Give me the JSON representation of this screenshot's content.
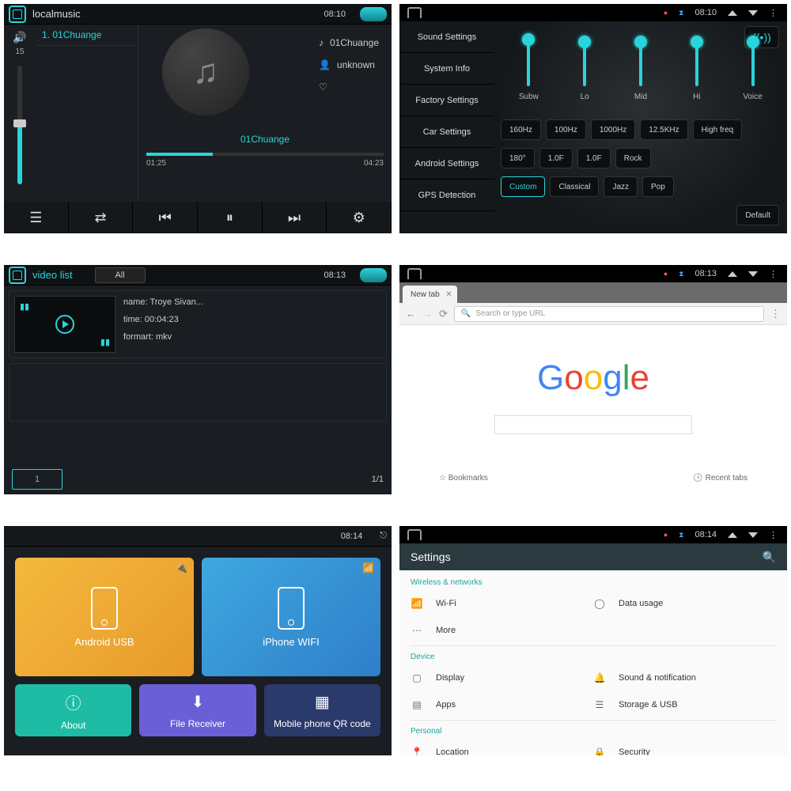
{
  "p1": {
    "title": "localmusic",
    "clock": "08:10",
    "volume_label": "15",
    "track": "1. 01Chuange",
    "song": "01Chuange",
    "artist": "unknown",
    "now_label": "01Chuange",
    "elapsed": "01:25",
    "total": "04:23"
  },
  "p2": {
    "clock": "08:10",
    "menu": [
      "Sound Settings",
      "System Info",
      "Factory Settings",
      "Car Settings",
      "Android Settings",
      "GPS Detection"
    ],
    "sliders": [
      "Subw",
      "Lo",
      "Mid",
      "Hi",
      "Voice"
    ],
    "freq": [
      "160Hz",
      "100Hz",
      "1000Hz",
      "12.5KHz",
      "High freq"
    ],
    "row2": [
      "180°",
      "1.0F",
      "1.0F",
      "Rock"
    ],
    "presets": [
      "Custom",
      "Classical",
      "Jazz",
      "Pop"
    ],
    "default": "Default"
  },
  "p3": {
    "title": "video list",
    "all": "All",
    "clock": "08:13",
    "name_lbl": "name:",
    "name_val": "Troye Sivan...",
    "time_lbl": "time:",
    "time_val": "00:04:23",
    "fmt_lbl": "formart:",
    "fmt_val": "mkv",
    "page_btn": "1",
    "page_of": "1/1"
  },
  "p4": {
    "clock": "08:13",
    "tab": "New tab",
    "placeholder": "Search or type URL",
    "bookmarks": "Bookmarks",
    "recent": "Recent tabs"
  },
  "p5": {
    "clock": "08:14",
    "android": "Android USB",
    "iphone": "iPhone WIFI",
    "about": "About",
    "file": "File Receiver",
    "qr": "Mobile phone QR code"
  },
  "p6": {
    "clock": "08:14",
    "title": "Settings",
    "s1": "Wireless & networks",
    "wifi": "Wi-Fi",
    "data": "Data usage",
    "more": "More",
    "s2": "Device",
    "display": "Display",
    "sound": "Sound & notification",
    "apps": "Apps",
    "storage": "Storage & USB",
    "s3": "Personal",
    "location": "Location",
    "security": "Security"
  }
}
